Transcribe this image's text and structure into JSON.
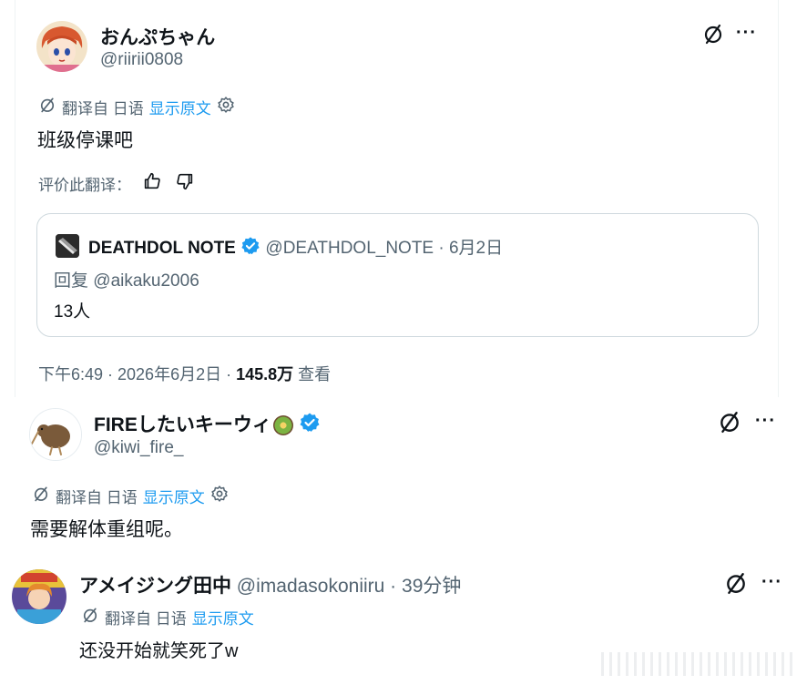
{
  "post1": {
    "display_name": "おんぷちゃん",
    "handle": "@riirii0808",
    "translated_from": "翻译自 日语",
    "show_original": "显示原文",
    "body": "班级停课吧",
    "rate_label": "评价此翻译：",
    "more": "···",
    "quote": {
      "display_name": "DEATHDOL NOTE",
      "handle_date": "@DEATHDOL_NOTE · 6月2日",
      "reply_to": "回复 @aikaku2006",
      "text": "13人"
    },
    "meta": {
      "time_date": "下午6:49 · 2026年6月2日 · ",
      "views": "145.8万",
      "views_label": " 查看"
    }
  },
  "post2": {
    "display_name": "FIREしたいキーウィ",
    "handle": "@kiwi_fire_",
    "translated_from": "翻译自 日语",
    "show_original": "显示原文",
    "body": "需要解体重组呢。",
    "more": "···"
  },
  "post3": {
    "display_name": "アメイジング田中",
    "handle_time": "@imadasokoniiru · 39分钟",
    "translated_from": "翻译自 日语",
    "show_original": "显示原文",
    "body": "还没开始就笑死了w",
    "more": "···"
  },
  "colors": {
    "text": "#0f1419",
    "secondary": "#536471",
    "accent": "#1d9bf0",
    "border": "#cfd9de"
  },
  "icons": [
    "translate-icon",
    "settings-icon",
    "thumbs-up-icon",
    "thumbs-down-icon",
    "verified-badge-icon",
    "more-icon"
  ]
}
